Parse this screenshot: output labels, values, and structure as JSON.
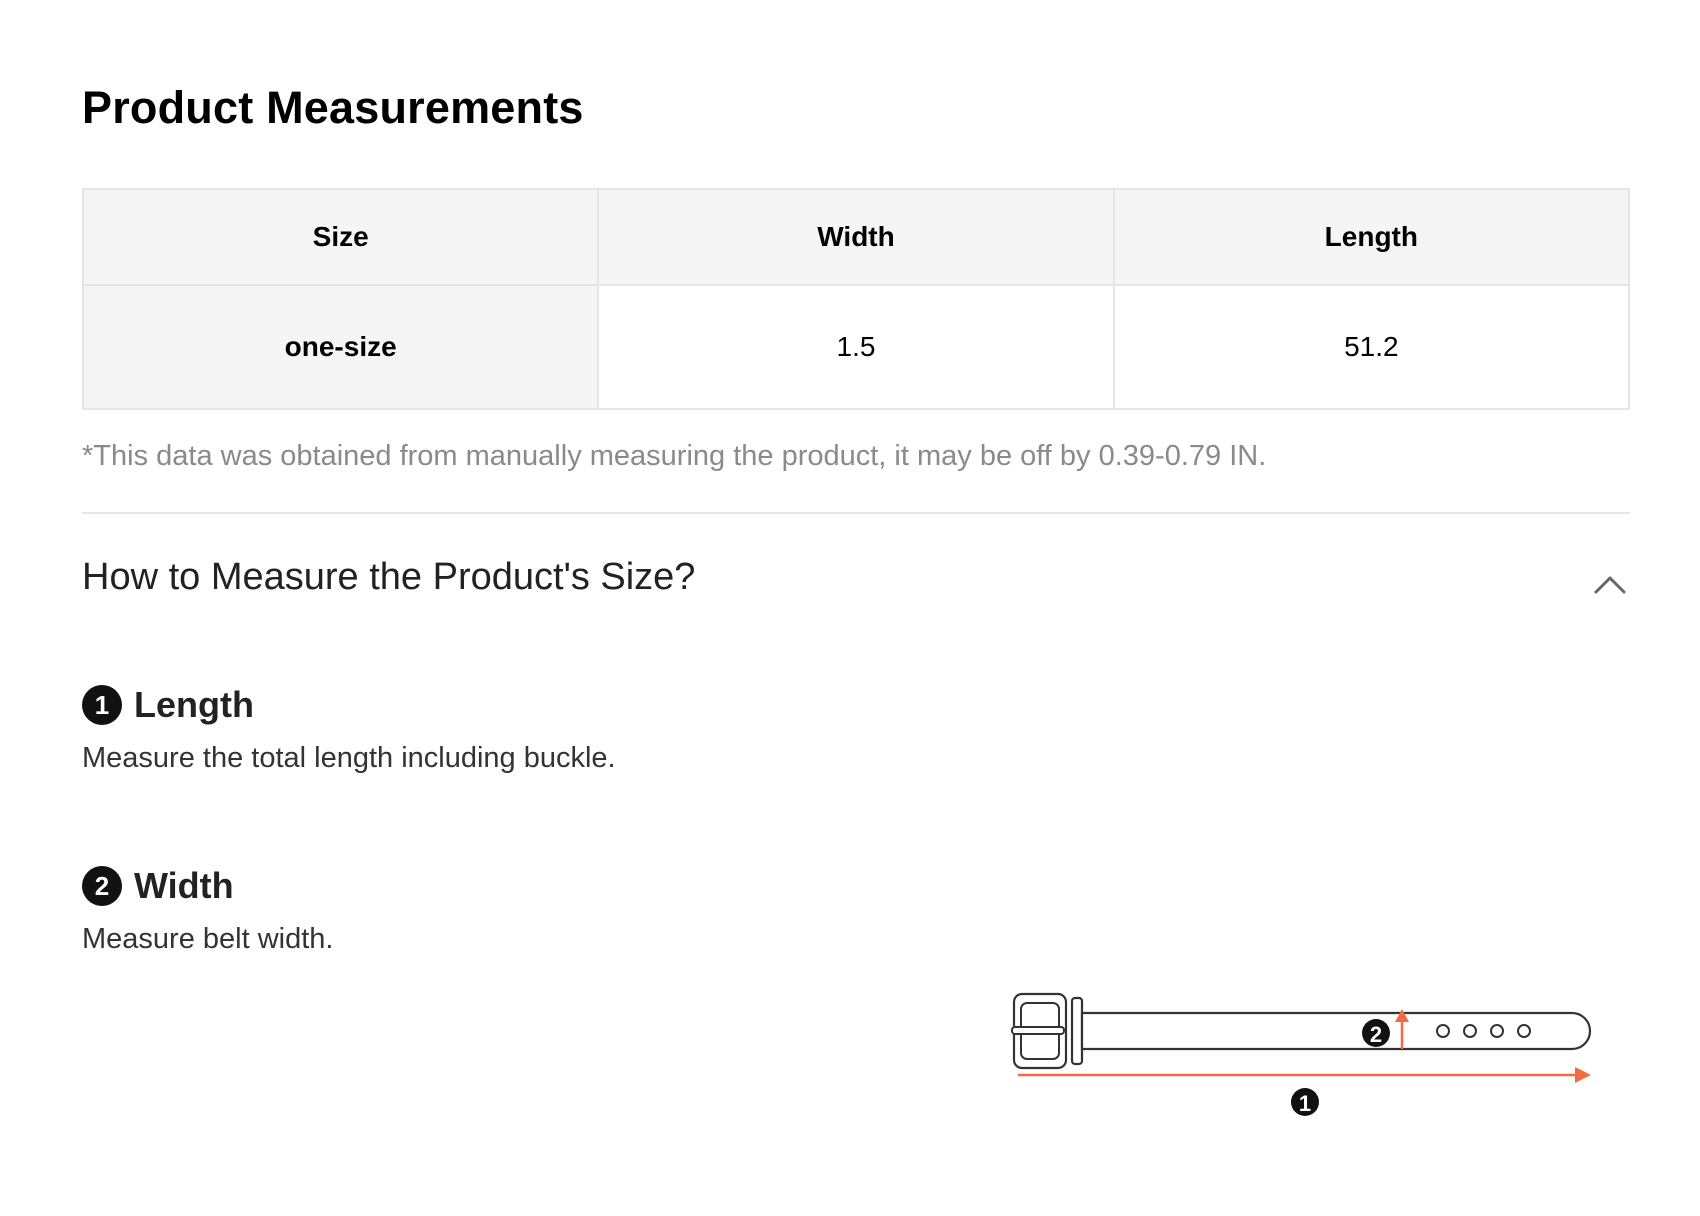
{
  "title": "Product Measurements",
  "table": {
    "headers": [
      "Size",
      "Width",
      "Length"
    ],
    "rows": [
      [
        "one-size",
        "1.5",
        "51.2"
      ]
    ]
  },
  "note": "*This data was obtained from manually measuring the product, it may be off by 0.39-0.79 IN.",
  "how_to": {
    "title": "How to Measure the Product's Size?",
    "toggle_icon": "chevron-up-icon",
    "items": [
      {
        "number": "1",
        "title": "Length",
        "description": "Measure the total length including buckle."
      },
      {
        "number": "2",
        "title": "Width",
        "description": "Measure belt width."
      }
    ]
  },
  "diagram": {
    "length_marker": "1",
    "width_marker": "2",
    "arrow_color": "#f26b43"
  }
}
